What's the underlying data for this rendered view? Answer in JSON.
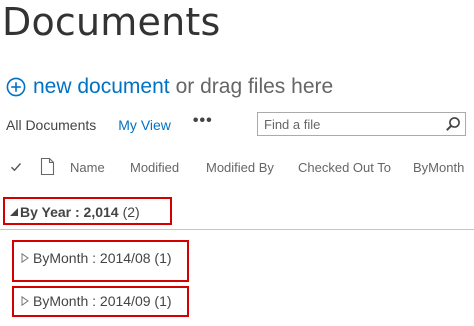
{
  "page": {
    "title": "Documents"
  },
  "toolbar": {
    "new_document_label": "new document",
    "drag_text": "or drag files here"
  },
  "views": {
    "all_documents": "All Documents",
    "my_view": "My View",
    "more": "•••"
  },
  "search": {
    "placeholder": "Find a file",
    "icon": "search-icon"
  },
  "columns": {
    "headers": [
      "Name",
      "Modified",
      "Modified By",
      "Checked Out To",
      "ByMonth"
    ]
  },
  "groups": [
    {
      "label": "By Year : 2,014",
      "count": "(2)",
      "expanded": true,
      "subgroups": [
        {
          "label": "ByMonth : 2014/08 (1)",
          "expanded": false
        },
        {
          "label": "ByMonth : 2014/09 (1)",
          "expanded": false
        }
      ]
    }
  ],
  "colors": {
    "accent": "#0072c6",
    "highlight": "#d40000",
    "text": "#444444",
    "muted": "#666666"
  }
}
